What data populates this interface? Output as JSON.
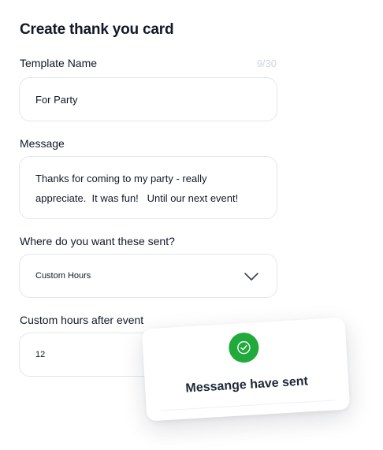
{
  "form": {
    "title": "Create thank you card",
    "template_name": {
      "label": "Template Name",
      "counter": "9/30",
      "value": "For Party"
    },
    "message": {
      "label": "Message",
      "value": "Thanks for coming to my party - really\nappreciate.  It was fun!   Until our next event!"
    },
    "where_sent": {
      "label": "Where do you want these sent?",
      "selected": "Custom Hours",
      "icon": "chevron-down-icon"
    },
    "custom_hours": {
      "label": "Custom hours after event",
      "value": "12"
    }
  },
  "toast": {
    "icon": "check-circle-icon",
    "icon_color": "#1faa3b",
    "text": "Messange have sent"
  }
}
